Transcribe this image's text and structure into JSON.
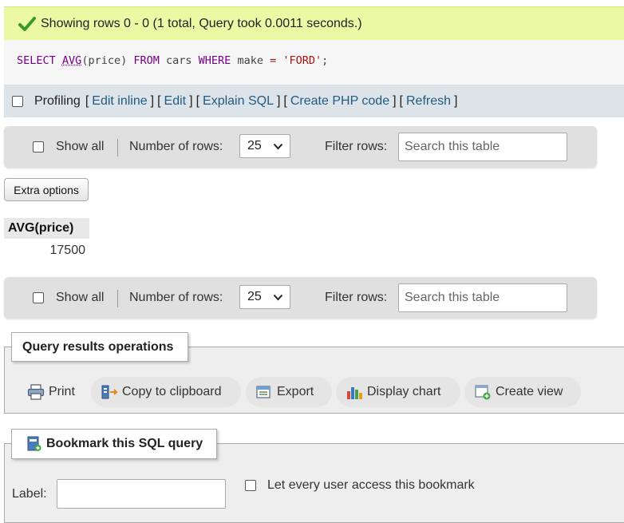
{
  "success": {
    "message": "Showing rows 0 - 0 (1 total, Query took 0.0011 seconds.)",
    "icon": "check-icon"
  },
  "sql": {
    "tokens": [
      "SELECT",
      "AVG",
      "(price)",
      "FROM",
      "cars",
      "WHERE",
      "make",
      "=",
      "'FORD'",
      ";"
    ]
  },
  "tools": {
    "profiling_label": "Profiling",
    "open_bracket": "[",
    "close_bracket": "]",
    "links": [
      "Edit inline",
      "Edit",
      "Explain SQL",
      "Create PHP code",
      "Refresh"
    ]
  },
  "nav": {
    "show_all_label": "Show all",
    "rows_label": "Number of rows:",
    "rows_value": "25",
    "filter_label": "Filter rows:",
    "filter_placeholder": "Search this table"
  },
  "extra_options_label": "Extra options",
  "result": {
    "header": "AVG(price)",
    "value": "17500"
  },
  "operations": {
    "legend": "Query results operations",
    "buttons": [
      {
        "label": "Print",
        "icon": "printer-icon"
      },
      {
        "label": "Copy to clipboard",
        "icon": "clipboard-icon"
      },
      {
        "label": "Export",
        "icon": "export-icon"
      },
      {
        "label": "Display chart",
        "icon": "bar-chart-icon"
      },
      {
        "label": "Create view",
        "icon": "create-view-icon"
      }
    ]
  },
  "bookmark": {
    "legend": "Bookmark this SQL query",
    "label_field_label": "Label:",
    "label_value": "",
    "share_label": "Let every user access this bookmark"
  },
  "colors": {
    "success_bg": "#ebf8a4",
    "link": "#235a81",
    "toolbar_bg": "#dce4ea"
  }
}
